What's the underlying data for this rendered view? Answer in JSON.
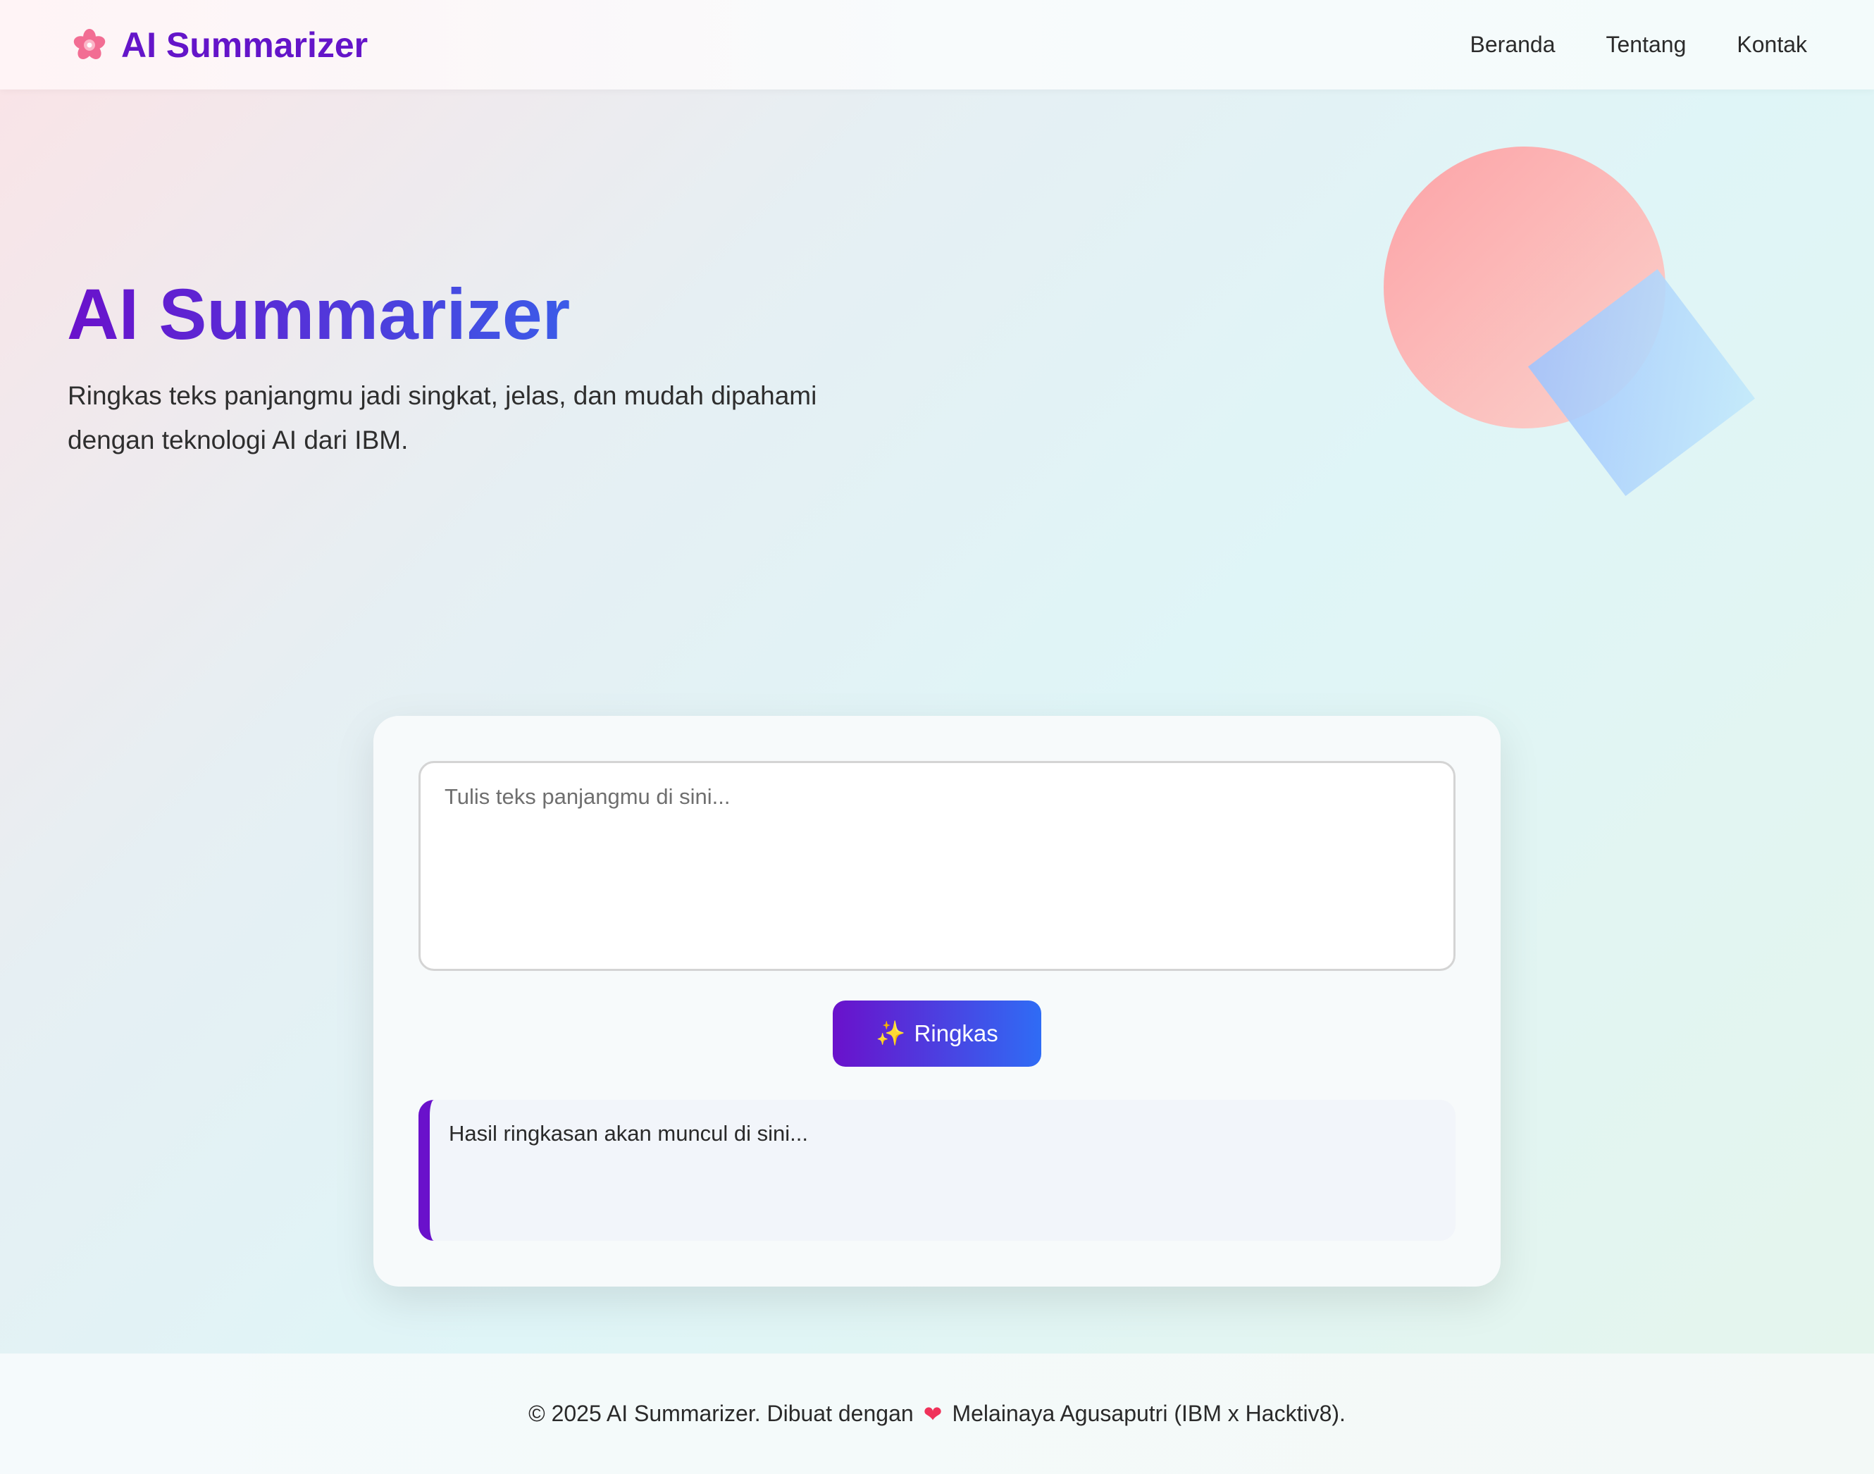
{
  "header": {
    "brand_icon": "flower-icon",
    "brand_title": "AI Summarizer",
    "nav": [
      {
        "label": "Beranda"
      },
      {
        "label": "Tentang"
      },
      {
        "label": "Kontak"
      }
    ]
  },
  "hero": {
    "title": "AI Summarizer",
    "subtitle_line1": "Ringkas teks panjangmu jadi singkat, jelas, dan mudah dipahami",
    "subtitle_line2": "dengan teknologi AI dari IBM."
  },
  "form": {
    "input_placeholder": "Tulis teks panjangmu di sini...",
    "input_value": "",
    "button_icon": "✨",
    "button_label": "Ringkas",
    "result_placeholder": "Hasil ringkasan akan muncul di sini..."
  },
  "footer": {
    "text_before": "© 2025 AI Summarizer. Dibuat dengan",
    "heart_icon": "❤",
    "text_after": "Melainaya Agusaputri (IBM x Hacktiv8)."
  },
  "colors": {
    "brand": "#6415c9",
    "gradient_start": "#6a11cb",
    "gradient_end": "#2f6cf5",
    "heart": "#f0325a"
  }
}
